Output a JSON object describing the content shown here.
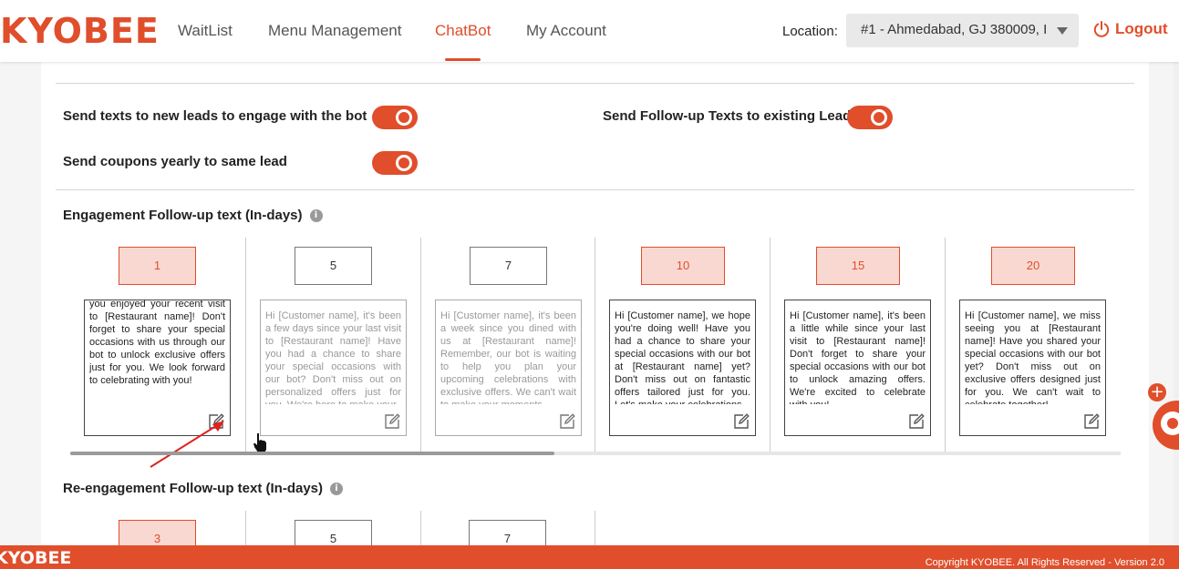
{
  "brand": {
    "logo": "KYOBEE",
    "accent": "#e04e2b"
  },
  "nav": {
    "items": [
      {
        "label": "WaitList"
      },
      {
        "label": "Menu Management"
      },
      {
        "label": "ChatBot"
      },
      {
        "label": "My Account"
      }
    ],
    "active": "ChatBot"
  },
  "location": {
    "label": "Location:",
    "value": "#1 - Ahmedabad, GJ 380009, In"
  },
  "logout": {
    "label": "Logout",
    "icon": "power-icon"
  },
  "toggles": {
    "new_leads": {
      "label": "Send texts to new leads to engage with the bot",
      "on": true
    },
    "follow_up": {
      "label": "Send Follow-up Texts to existing Leads",
      "on": true
    },
    "coupons": {
      "label": "Send coupons yearly to same lead",
      "on": true
    }
  },
  "engagement": {
    "title": "Engagement Follow-up text (In-days)",
    "items": [
      {
        "day": "1",
        "message": "you enjoyed your recent visit to [Restaurant name]! Don't forget to share your special occasions with us through our bot to unlock exclusive offers just for you. We look forward to celebrating with you!"
      },
      {
        "day": "5",
        "message": "Hi [Customer name], it's been a few days since your last visit to [Restaurant name]! Have you had a chance to share your special occasions with our bot? Don't miss out on personalized offers just for you. We're here to make your"
      },
      {
        "day": "7",
        "message": "Hi [Customer name], it's been a week since you dined with us at [Restaurant name]! Remember, our bot is waiting to help you plan your upcoming celebrations with exclusive offers. We can't wait to make your moments"
      },
      {
        "day": "10",
        "message": "Hi [Customer name], we hope you're doing well! Have you had a chance to share your special occasions with our bot at [Restaurant name] yet? Don't miss out on fantastic offers tailored just for you. Let's make your celebrations"
      },
      {
        "day": "15",
        "message": "Hi [Customer name], it's been a little while since your last visit to [Restaurant name]! Don't forget to share your special occasions with our bot to unlock amazing offers. We're excited to celebrate with you!"
      },
      {
        "day": "20",
        "message": "Hi [Customer name], we miss seeing you at [Restaurant name]! Have you shared your special occasions with our bot yet? Don't miss out on exclusive offers designed just for you. We can't wait to celebrate together!"
      }
    ]
  },
  "reengagement": {
    "title": "Re-engagement Follow-up text (In-days)",
    "items": [
      {
        "day": "3"
      },
      {
        "day": "5"
      },
      {
        "day": "7"
      }
    ]
  },
  "footer": {
    "logo": "KYOBEE",
    "copyright": "Copyright KYOBEE. All Rights Reserved - Version 2.0"
  }
}
